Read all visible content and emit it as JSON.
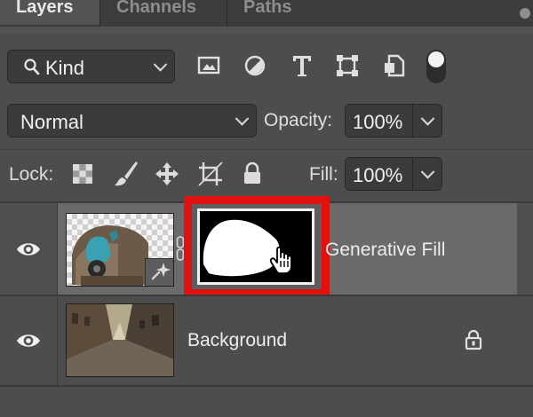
{
  "panel": {
    "tabs": [
      {
        "label": "Layers"
      },
      {
        "label": "Channels"
      },
      {
        "label": "Paths"
      }
    ]
  },
  "filter": {
    "kind_label": "Kind",
    "icons": [
      "image-filter-icon",
      "adjustment-filter-icon",
      "type-filter-icon",
      "shape-filter-icon",
      "smart-object-filter-icon",
      "filter-toggle-icon"
    ]
  },
  "blend": {
    "mode": "Normal"
  },
  "opacity": {
    "label": "Opacity:",
    "value": "100%"
  },
  "lock": {
    "label": "Lock:",
    "icons": [
      "lock-transparent-pixels-icon",
      "lock-image-pixels-icon",
      "lock-position-icon",
      "lock-artboard-icon",
      "lock-all-icon"
    ]
  },
  "fill": {
    "label": "Fill:",
    "value": "100%"
  },
  "layers": [
    {
      "name": "Generative Fill",
      "selected": true,
      "visible": true
    },
    {
      "name": "Background",
      "selected": false,
      "visible": true,
      "locked": true
    }
  ],
  "colors": {
    "highlight": "#e31010",
    "selected_row": "#6a6a6a",
    "panel_bg": "#4d4d4d"
  }
}
